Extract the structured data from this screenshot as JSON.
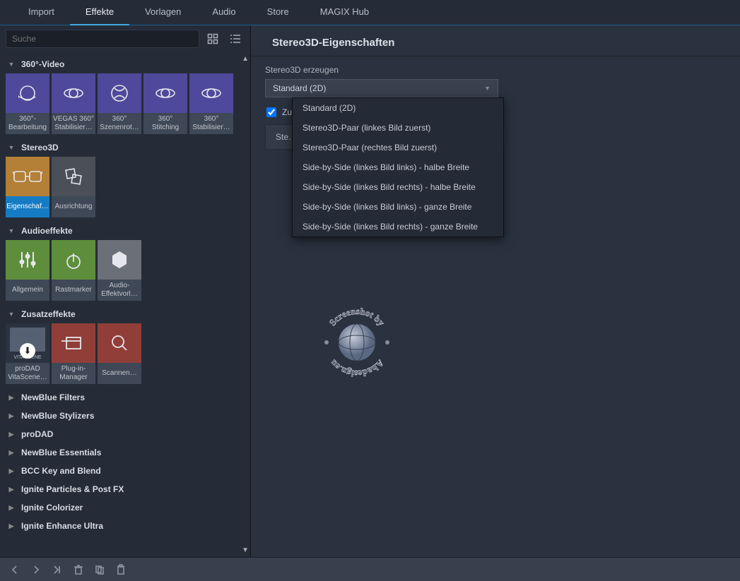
{
  "topnav": {
    "tabs": [
      {
        "label": "Import",
        "active": false
      },
      {
        "label": "Effekte",
        "active": true
      },
      {
        "label": "Vorlagen",
        "active": false
      },
      {
        "label": "Audio",
        "active": false
      },
      {
        "label": "Store",
        "active": false
      },
      {
        "label": "MAGIX Hub",
        "active": false
      }
    ]
  },
  "search": {
    "placeholder": "Suche"
  },
  "categories": [
    {
      "name": "360°-Video",
      "open": true,
      "tiles": [
        {
          "label": "360°-Bearbeitung",
          "icon": "rotate-360",
          "bg": "#4f499b"
        },
        {
          "label": "VEGAS 360° Stabilisier…",
          "icon": "rings",
          "bg": "#4f499b"
        },
        {
          "label": "360° Szenenrot…",
          "icon": "globe-360",
          "bg": "#4f499b"
        },
        {
          "label": "360° Stitching",
          "icon": "rings",
          "bg": "#4f499b"
        },
        {
          "label": "360° Stabilisier…",
          "icon": "rings",
          "bg": "#4f499b"
        }
      ]
    },
    {
      "name": "Stereo3D",
      "open": true,
      "tiles": [
        {
          "label": "Eigenschaf…",
          "icon": "glasses-3d",
          "bg": "#b47f36",
          "selected": true
        },
        {
          "label": "Ausrichtung",
          "icon": "align-cards",
          "bg": "#4b4f58"
        }
      ]
    },
    {
      "name": "Audioeffekte",
      "open": true,
      "tiles": [
        {
          "label": "Allgemein",
          "icon": "sliders",
          "bg": "#5e8e3c"
        },
        {
          "label": "Rastmarker",
          "icon": "dial",
          "bg": "#5e8e3c"
        },
        {
          "label": "Audio-Effektvorl…",
          "icon": "hex",
          "bg": "#6a6f78"
        }
      ]
    },
    {
      "name": "Zusatzeffekte",
      "open": true,
      "tiles": [
        {
          "label": "proDAD VitaScene…",
          "icon": "vitascene",
          "bg": "#3a4252"
        },
        {
          "label": "Plug-in-Manager",
          "icon": "layers",
          "bg": "#913e39"
        },
        {
          "label": "Scannen…",
          "icon": "magnify",
          "bg": "#913e39"
        }
      ]
    }
  ],
  "collapsed_categories": [
    "NewBlue Filters",
    "NewBlue Stylizers",
    "proDAD",
    "NewBlue Essentials",
    "BCC Key and Blend",
    "Ignite Particles & Post FX",
    "Ignite Colorizer",
    "Ignite Enhance Ultra"
  ],
  "panel": {
    "title": "Stereo3D-Eigenschaften",
    "field_label": "Stereo3D erzeugen",
    "selected": "Standard (2D)",
    "checkbox_label": "Zu…",
    "option_slab": "Ste…",
    "options": [
      "Standard (2D)",
      "Stereo3D-Paar (linkes Bild zuerst)",
      "Stereo3D-Paar (rechtes Bild zuerst)",
      "Side-by-Side (linkes Bild links) - halbe Breite",
      "Side-by-Side (linkes Bild rechts) - halbe Breite",
      "Side-by-Side (linkes Bild links) - ganze Breite",
      "Side-by-Side (linkes Bild rechts) - ganze Breite"
    ]
  },
  "watermark": {
    "line1": "Screenshot by",
    "line2": "Ahadesign.eu"
  },
  "footer_icons": [
    "back",
    "forward",
    "jump",
    "trash",
    "copy",
    "paste"
  ]
}
